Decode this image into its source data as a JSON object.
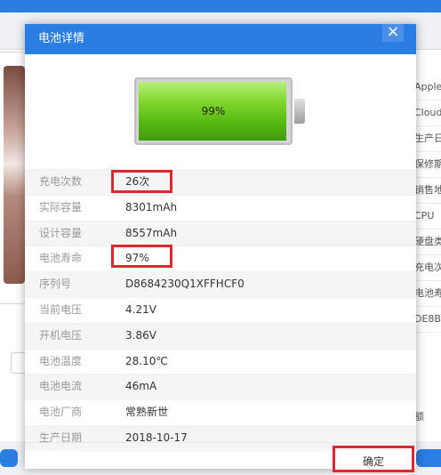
{
  "background": {
    "right_labels": [
      "Apple",
      "Cloud",
      "生产日",
      "保修期",
      "销售地",
      "CPU",
      "硬盘类",
      "充电次",
      "电池寿",
      "DE8B"
    ],
    "right_extra": "额"
  },
  "dialog": {
    "title": "电池详情",
    "close_symbol": "×",
    "battery": {
      "percent_text": "99%",
      "level": 0.99
    },
    "rows": [
      {
        "label": "充电次数",
        "value": "26次"
      },
      {
        "label": "实际容量",
        "value": "8301mAh"
      },
      {
        "label": "设计容量",
        "value": "8557mAh"
      },
      {
        "label": "电池寿命",
        "value": "97%"
      },
      {
        "label": "序列号",
        "value": "D8684230Q1XFFHCF0"
      },
      {
        "label": "当前电压",
        "value": "4.21V"
      },
      {
        "label": "开机电压",
        "value": "3.86V"
      },
      {
        "label": "电池温度",
        "value": "28.10℃"
      },
      {
        "label": "电池电流",
        "value": "46mA"
      },
      {
        "label": "电池厂商",
        "value": "常熟新世"
      },
      {
        "label": "生产日期",
        "value": "2018-10-17"
      }
    ],
    "confirm_label": "确定"
  }
}
